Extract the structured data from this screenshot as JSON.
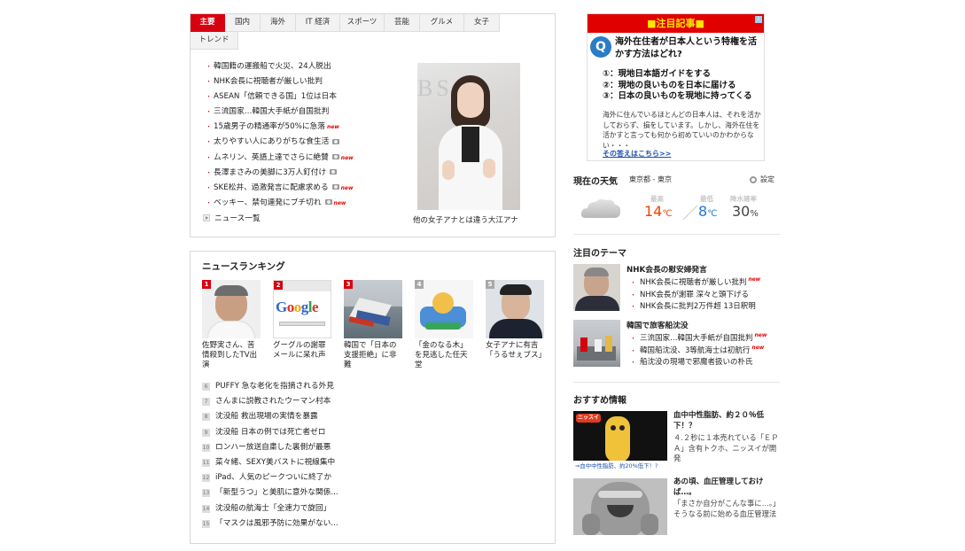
{
  "tabs": {
    "row1": [
      "主要",
      "国内",
      "海外",
      "IT 経済",
      "スポーツ",
      "芸能",
      "グルメ",
      "女子"
    ],
    "row2": [
      "トレンド"
    ]
  },
  "news": {
    "items": [
      {
        "text": "韓国籍の運搬船で火災、24人脱出",
        "camera": false,
        "new": false
      },
      {
        "text": "NHK会長に視聴者が厳しい批判",
        "camera": false,
        "new": false
      },
      {
        "text": "ASEAN「信頼できる国」1位は日本",
        "camera": false,
        "new": false
      },
      {
        "text": "三流国家…韓国大手紙が自国批判",
        "camera": false,
        "new": false
      },
      {
        "text": "15歳男子の精通率が50%に急落",
        "camera": false,
        "new": true
      },
      {
        "text": "太りやすい人にありがちな食生活",
        "camera": true,
        "new": false
      },
      {
        "text": "ムネリン、英語上達でさらに絶賛",
        "camera": true,
        "new": true
      },
      {
        "text": "長澤まさみの美脚に3万人釘付け",
        "camera": true,
        "new": false
      },
      {
        "text": "SKE松井、過激発言に配慮求める",
        "camera": true,
        "new": true
      },
      {
        "text": "ベッキー、禁句連発にブチ切れ",
        "camera": true,
        "new": true
      }
    ],
    "more_label": "ニュース一覧",
    "new_badge": "new",
    "feature_caption": "他の女子アナとは違う大江アナ",
    "feature_bg_text": "BS"
  },
  "ranking": {
    "title": "ニュースランキング",
    "cards": [
      {
        "rank": "1",
        "caption": "佐野実さん、苦情殺到したTV出演"
      },
      {
        "rank": "2",
        "caption": "グーグルの謝罪メールに呆れ声"
      },
      {
        "rank": "3",
        "caption": "韓国で「日本の支援拒絶」に非難"
      },
      {
        "rank": "4",
        "caption": "「金のなる木」を見逃した任天堂"
      },
      {
        "rank": "5",
        "caption": "女子アナに有吉「うるせぇブス」"
      }
    ],
    "google_text": "Google",
    "list": [
      {
        "rank": "6",
        "text": "PUFFY 急な老化を指摘される外見"
      },
      {
        "rank": "7",
        "text": "さんまに説教されたウーマン村本"
      },
      {
        "rank": "8",
        "text": "沈没船 救出現場の実情を暴露"
      },
      {
        "rank": "9",
        "text": "沈没船 日本の例では死亡者ゼロ"
      },
      {
        "rank": "10",
        "text": "ロンハー放送自粛した裏側が最悪"
      },
      {
        "rank": "11",
        "text": "菜々緒、SEXY美バストに視線集中"
      },
      {
        "rank": "12",
        "text": "iPad、人気のピークついに終了か"
      },
      {
        "rank": "13",
        "text": "「新型うつ」と美肌に意外な関係..."
      },
      {
        "rank": "14",
        "text": "沈没船の航海士「全速力で旋回」"
      },
      {
        "rank": "15",
        "text": "「マスクは風邪予防に効果がない..."
      }
    ]
  },
  "ad": {
    "header": "■注目記事■",
    "q_mark": "Q",
    "info_mark": "i",
    "headline": "海外在住者が日本人という特権を活かす方法はどれ?",
    "options": [
      "①：現地日本語ガイドをする",
      "②：現地の良いものを日本に届ける",
      "③：日本の良いものを現地に持ってくる"
    ],
    "body": "海外に住んでいるほとんどの日本人は、それを活かしておらず、損をしています。しかし、海外在住を活かすと言っても何から初めていいのかわからない・・・",
    "link": "その答えはこちら>>"
  },
  "weather": {
    "title": "現在の天気",
    "location": "東京都 - 東京",
    "settings_label": "設定",
    "high_label": "最高",
    "low_label": "最低",
    "rain_label": "降水確率",
    "high_value": "14",
    "low_value": "8",
    "rain_value": "30",
    "temp_unit": "℃",
    "rain_unit": "%",
    "slash": "／",
    "high_color": "#ee4400",
    "low_color": "#2277dd"
  },
  "themes": {
    "title": "注目のテーマ",
    "groups": [
      {
        "title": "NHK会長の慰安婦発言",
        "links": [
          {
            "text": "NHK会長に視聴者が厳しい批判",
            "new": true
          },
          {
            "text": "NHK会長が謝罪 深々と頭下げる",
            "new": false
          },
          {
            "text": "NHK会長に批判2万件超 13日釈明",
            "new": false
          }
        ]
      },
      {
        "title": "韓国で旅客船沈没",
        "links": [
          {
            "text": "三流国家…韓国大手紙が自国批判",
            "new": true
          },
          {
            "text": "韓国船沈没、3等航海士は初航行",
            "new": true
          },
          {
            "text": "船沈没の現場で邪魔者扱いの朴氏",
            "new": false
          }
        ]
      }
    ]
  },
  "recommend": {
    "title": "おすすめ情報",
    "items": [
      {
        "title": "血中中性脂肪、約２０％低下！？",
        "desc": "４.２秒に１本売れている「ＥＰＡ」含有トクホ、ニッスイが開発",
        "thumb_banner": "⇒血中中性脂肪、約20%低下！?",
        "thumb_logo": "ニッスイ"
      },
      {
        "title": "あの頃、血圧管理しておけば…。",
        "desc": "「まさか自分がこんな事に…。」そうなる前に始める血圧管理法"
      }
    ]
  }
}
